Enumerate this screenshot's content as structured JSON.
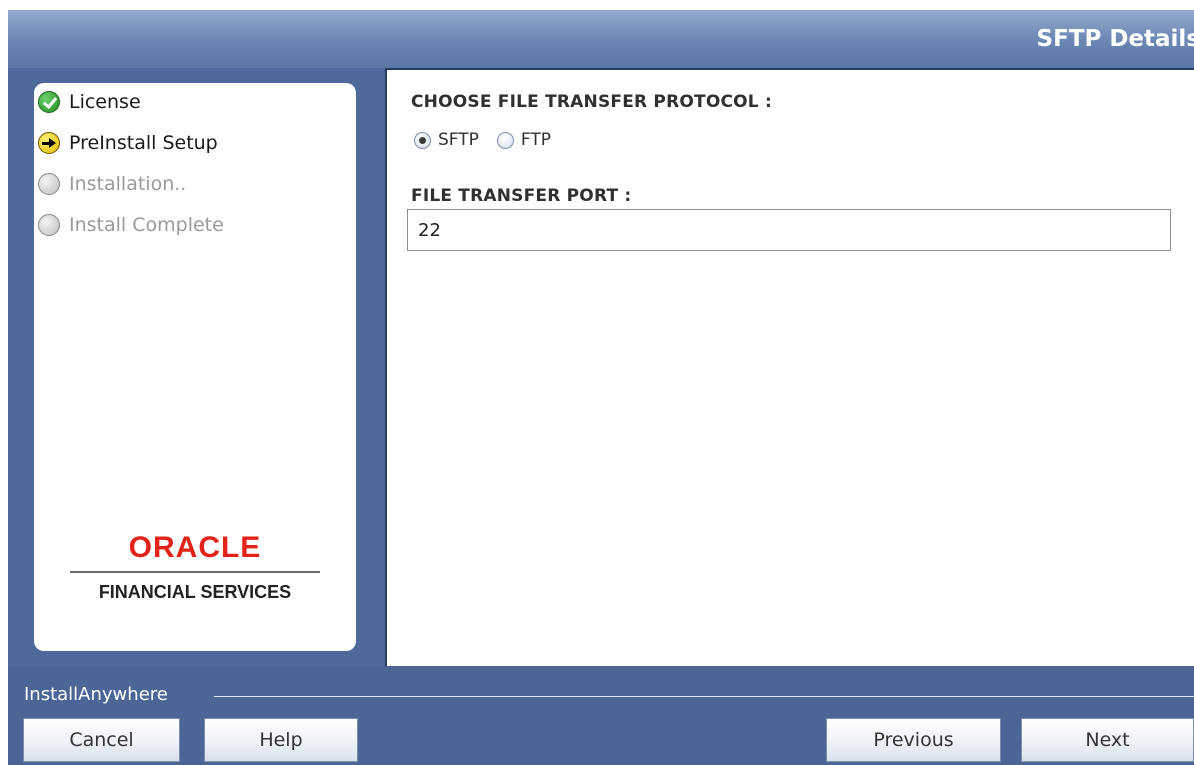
{
  "window": {
    "title": "SFTP Details"
  },
  "sidebar": {
    "steps": [
      {
        "label": "License",
        "status": "done",
        "icon": "check-circle-icon"
      },
      {
        "label": "PreInstall Setup",
        "status": "current",
        "icon": "arrow-circle-icon"
      },
      {
        "label": "Installation..",
        "status": "pending",
        "icon": "empty-circle-icon"
      },
      {
        "label": "Install Complete",
        "status": "pending",
        "icon": "empty-circle-icon"
      }
    ],
    "logo": {
      "brand": "ORACLE",
      "tagline": "FINANCIAL SERVICES"
    }
  },
  "main": {
    "protocol_label": "CHOOSE FILE TRANSFER PROTOCOL :",
    "protocol_options": [
      {
        "label": "SFTP",
        "checked": true
      },
      {
        "label": "FTP",
        "checked": false
      }
    ],
    "port_label": "FILE TRANSFER PORT :",
    "port_value": "22"
  },
  "footer": {
    "installer_name": "InstallAnywhere",
    "buttons": {
      "cancel": "Cancel",
      "help": "Help",
      "previous": "Previous",
      "next": "Next"
    }
  },
  "colors": {
    "frame": "#4b6696",
    "oracle_red": "#e2231a"
  }
}
